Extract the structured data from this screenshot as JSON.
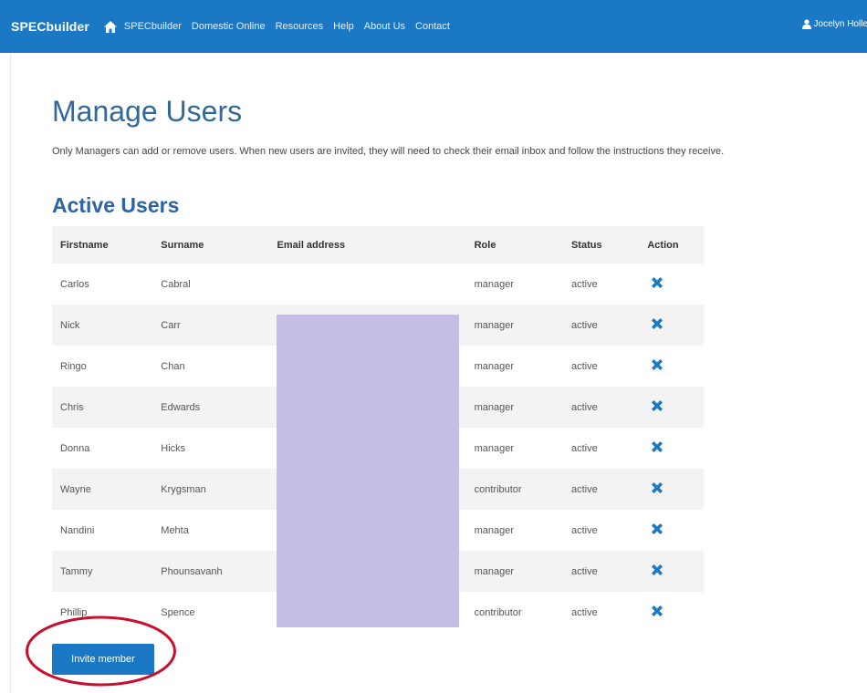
{
  "navbar": {
    "brand": "SPECbuilder",
    "links": [
      "SPECbuilder",
      "Domestic Online",
      "Resources",
      "Help",
      "About Us",
      "Contact"
    ],
    "user": "Jocelyn Holley",
    "color": "#1b78c4"
  },
  "page": {
    "title": "Manage Users",
    "intro": "Only Managers can add or remove users. When new users are invited, they will need to check their email inbox and follow the instructions they receive.",
    "section_title": "Active Users"
  },
  "table": {
    "columns": [
      "Firstname",
      "Surname",
      "Email address",
      "Role",
      "Status",
      "Action"
    ],
    "rows": [
      {
        "firstname": "Carlos",
        "surname": "Cabral",
        "role": "manager",
        "status": "active"
      },
      {
        "firstname": "Nick",
        "surname": "Carr",
        "role": "manager",
        "status": "active"
      },
      {
        "firstname": "Ringo",
        "surname": "Chan",
        "role": "manager",
        "status": "active"
      },
      {
        "firstname": "Chris",
        "surname": "Edwards",
        "role": "manager",
        "status": "active"
      },
      {
        "firstname": "Donna",
        "surname": "Hicks",
        "role": "manager",
        "status": "active"
      },
      {
        "firstname": "Wayne",
        "surname": "Krygsman",
        "role": "contributor",
        "status": "active"
      },
      {
        "firstname": "Nandini",
        "surname": "Mehta",
        "role": "manager",
        "status": "active"
      },
      {
        "firstname": "Tammy",
        "surname": "Phounsavanh",
        "role": "manager",
        "status": "active"
      },
      {
        "firstname": "Phillip",
        "surname": "Spence",
        "role": "contributor",
        "status": "active"
      }
    ],
    "action_icon": "remove-x-icon",
    "action_color": "#1b78c4"
  },
  "invite_button": {
    "label": "Invite member"
  },
  "annotation": {
    "color": "#c8102e"
  }
}
